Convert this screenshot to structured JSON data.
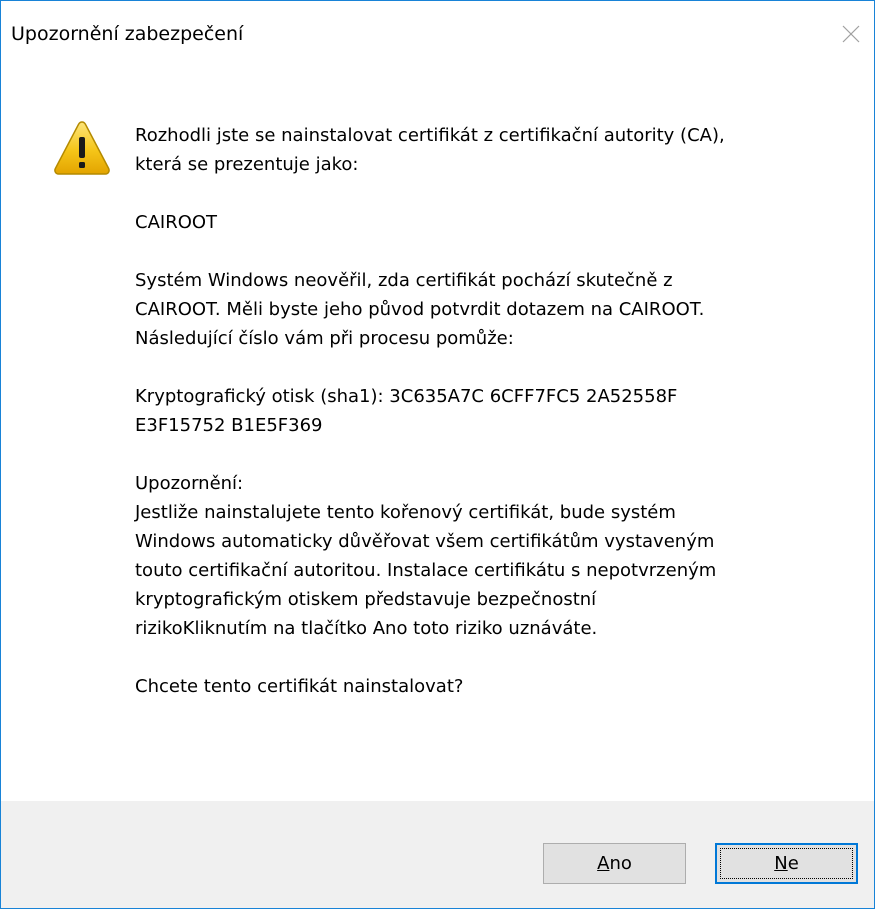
{
  "window": {
    "title": "Upozornění zabezpečení"
  },
  "icons": {
    "warning": "warning-triangle-icon",
    "close": "close-icon"
  },
  "message": {
    "intro": [
      "Rozhodli jste se nainstalovat certifikát z certifikační autority (CA),",
      "která se prezentuje jako:"
    ],
    "ca_name": "CAIROOT",
    "verify": [
      "Systém Windows neověřil, zda certifikát pochází skutečně z",
      "CAIROOT. Měli byste jeho původ potvrdit dotazem na CAIROOT.",
      "Následující číslo vám při procesu pomůže:"
    ],
    "thumbprint": [
      "Kryptografický otisk (sha1): 3C635A7C 6CFF7FC5 2A52558F",
      "E3F15752 B1E5F369"
    ],
    "warning_heading": "Upozornění:",
    "warning_body": [
      "Jestliže nainstalujete tento kořenový certifikát, bude systém",
      "Windows automaticky důvěřovat všem certifikátům vystaveným",
      "touto certifikační autoritou. Instalace certifikátu s nepotvrzeným",
      "kryptografickým otiskem představuje bezpečnostní",
      "rizikoKliknutím na tlačítko Ano toto riziko uznáváte."
    ],
    "question": "Chcete tento certifikát nainstalovat?"
  },
  "buttons": {
    "yes": {
      "mnemonic": "A",
      "rest": "no"
    },
    "no": {
      "mnemonic": "N",
      "rest": "e"
    }
  },
  "colors": {
    "border": "#1883d7",
    "footer": "#f0f0f0",
    "button_face": "#e1e1e1",
    "default_button_border": "#0078d7",
    "warning_yellow": "#f5c518"
  }
}
